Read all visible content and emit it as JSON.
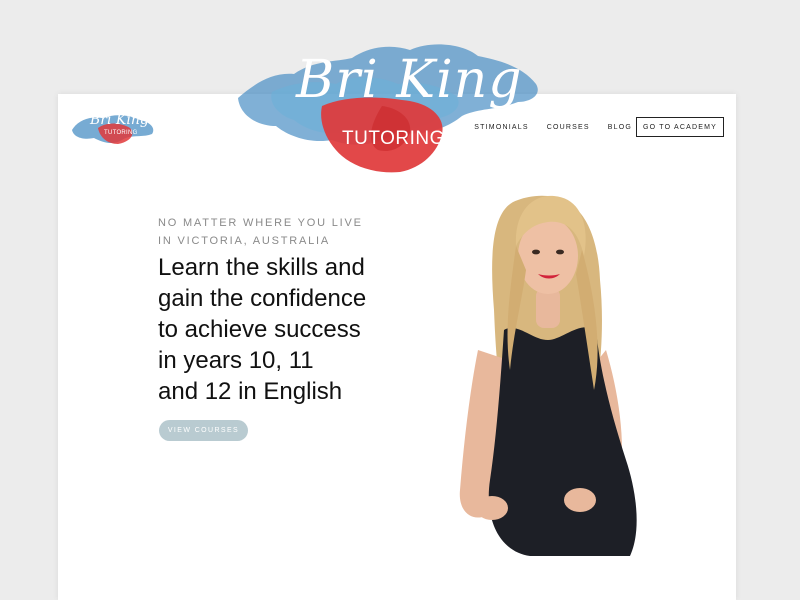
{
  "brand": {
    "script_name": "Bri King",
    "subtitle": "TUTORING"
  },
  "nav": {
    "items": [
      "STIMONIALS",
      "COURSES",
      "BLOG"
    ],
    "cta_label": "GO TO ACADEMY"
  },
  "hero": {
    "eyebrow_lines": [
      "NO MATTER WHERE YOU LIVE",
      "IN VICTORIA, AUSTRALIA"
    ],
    "headline_lines": [
      "Learn the skills and",
      "gain the confidence",
      "to achieve success",
      "in years 10, 11",
      "and 12 in English"
    ],
    "button_label": "VIEW COURSES"
  },
  "colors": {
    "page_bg": "#ececec",
    "card_bg": "#ffffff",
    "watercolor_blue": "#4a8fc4",
    "watercolor_red": "#e0383a",
    "button_bg": "#b9cbd1",
    "text_dark": "#111111"
  }
}
